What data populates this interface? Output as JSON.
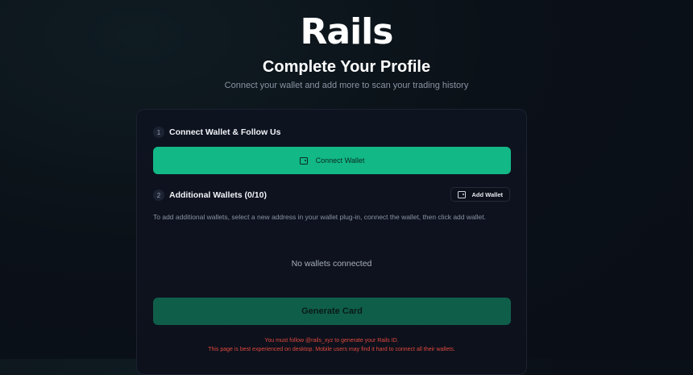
{
  "brand": {
    "logo_text": "Rails"
  },
  "header": {
    "title": "Complete Your Profile",
    "subtitle": "Connect your wallet and add more to scan your trading history"
  },
  "steps": [
    {
      "number": "1",
      "label": "Connect Wallet & Follow Us"
    },
    {
      "number": "2",
      "label": "Additional Wallets (0/10)"
    }
  ],
  "buttons": {
    "connect_wallet": "Connect Wallet",
    "add_wallet": "Add Wallet",
    "generate_card": "Generate Card"
  },
  "additional_wallets": {
    "description": "To add additional wallets, select a new address in your wallet plug-in, connect the wallet, then click add wallet.",
    "empty_state": "No wallets connected"
  },
  "warnings": {
    "follow": "You must follow @rails_xyz to generate your Rails ID.",
    "desktop": "This page is best experienced on desktop. Mobile users may find it hard to connect all their wallets."
  },
  "colors": {
    "accent": "#12b886",
    "accent_disabled": "#0f5e49",
    "warning": "#e0483d",
    "background": "#0a0e17"
  },
  "icons": {
    "connect_wallet": "wallet-icon",
    "add_wallet": "wallet-icon"
  }
}
